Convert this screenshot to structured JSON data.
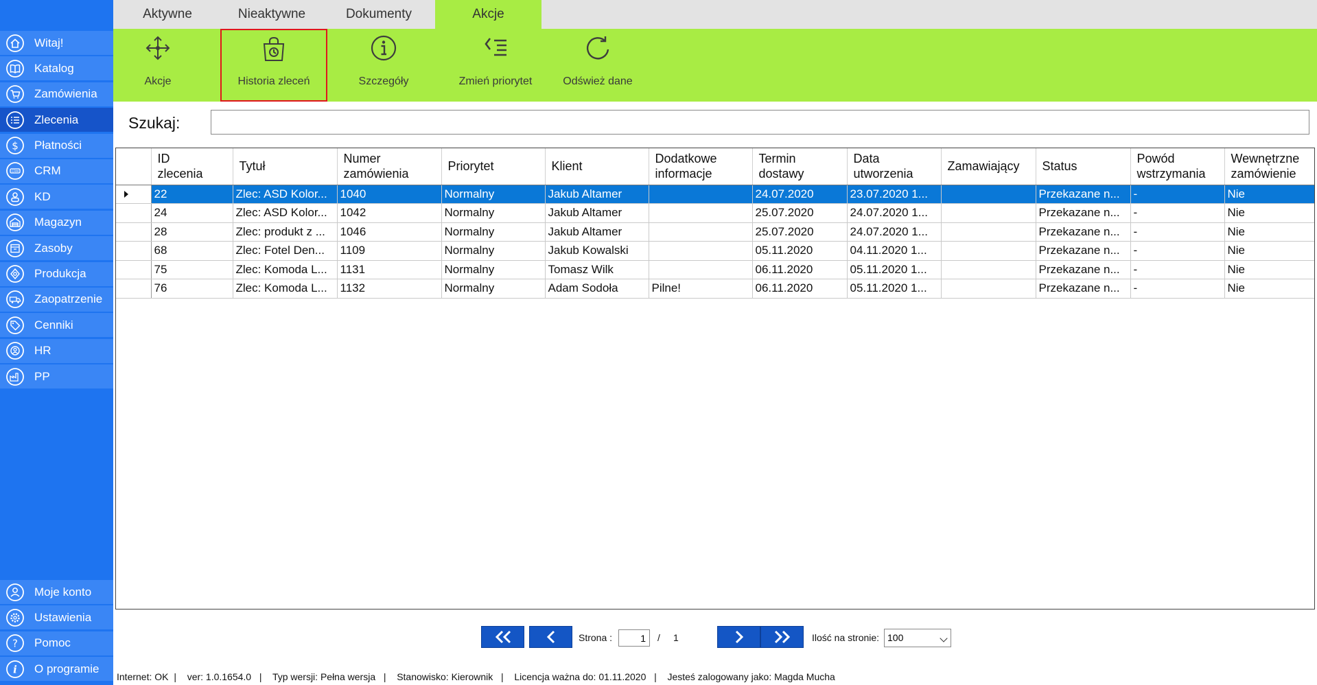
{
  "sidebar": {
    "items": [
      {
        "label": "Witaj!",
        "icon": "home-icon"
      },
      {
        "label": "Katalog",
        "icon": "book-icon"
      },
      {
        "label": "Zamówienia",
        "icon": "cart-icon"
      },
      {
        "label": "Zlecenia",
        "icon": "list-icon",
        "active": true
      },
      {
        "label": "Płatności",
        "icon": "dollar-icon"
      },
      {
        "label": "CRM",
        "icon": "crm-icon"
      },
      {
        "label": "KD",
        "icon": "person-icon"
      },
      {
        "label": "Magazyn",
        "icon": "warehouse-icon"
      },
      {
        "label": "Zasoby",
        "icon": "box-icon"
      },
      {
        "label": "Produkcja",
        "icon": "production-icon"
      },
      {
        "label": "Zaopatrzenie",
        "icon": "truck-icon"
      },
      {
        "label": "Cenniki",
        "icon": "tag-icon"
      },
      {
        "label": "HR",
        "icon": "hr-icon"
      },
      {
        "label": "PP",
        "icon": "factory-icon"
      }
    ],
    "bottom_items": [
      {
        "label": "Moje konto",
        "icon": "user-icon"
      },
      {
        "label": "Ustawienia",
        "icon": "gear-icon"
      },
      {
        "label": "Pomoc",
        "icon": "question-icon"
      },
      {
        "label": "O programie",
        "icon": "info-icon"
      }
    ]
  },
  "tabs": [
    {
      "label": "Aktywne"
    },
    {
      "label": "Nieaktywne"
    },
    {
      "label": "Dokumenty"
    },
    {
      "label": "Akcje",
      "active": true
    }
  ],
  "ribbon": {
    "buttons": [
      {
        "label": "Akcje",
        "icon": "move-arrows-icon"
      },
      {
        "label": "Historia zleceń",
        "icon": "history-bag-icon",
        "selected": true
      },
      {
        "label": "Szczegóły",
        "icon": "info-circle-icon"
      },
      {
        "label": "Zmień priorytet",
        "icon": "priority-list-icon"
      },
      {
        "label": "Odśwież dane",
        "icon": "refresh-icon"
      }
    ]
  },
  "search": {
    "label": "Szukaj:",
    "value": ""
  },
  "table": {
    "columns": [
      "ID\nzlecenia",
      "Tytuł",
      "Numer\nzamówienia",
      "Priorytet",
      "Klient",
      "Dodatkowe\ninformacje",
      "Termin\ndostawy",
      "Data\nutworzenia",
      "Zamawiający",
      "Status",
      "Powód\nwstrzymania",
      "Wewnętrzne\nzamówienie"
    ],
    "rows": [
      [
        "22",
        "Zlec: ASD Kolor...",
        "1040",
        "Normalny",
        "Jakub  Altamer",
        "",
        "24.07.2020",
        "23.07.2020 1...",
        "",
        "Przekazane n...",
        "-",
        "Nie"
      ],
      [
        "24",
        "Zlec: ASD Kolor...",
        "1042",
        "Normalny",
        "Jakub  Altamer",
        "",
        "25.07.2020",
        "24.07.2020 1...",
        "",
        "Przekazane n...",
        "-",
        "Nie"
      ],
      [
        "28",
        "Zlec: produkt z ...",
        "1046",
        "Normalny",
        "Jakub  Altamer",
        "",
        "25.07.2020",
        "24.07.2020 1...",
        "",
        "Przekazane n...",
        "-",
        "Nie"
      ],
      [
        "68",
        "Zlec: Fotel Den...",
        "1109",
        "Normalny",
        "Jakub Kowalski",
        "",
        "05.11.2020",
        "04.11.2020 1...",
        "",
        "Przekazane n...",
        "-",
        "Nie"
      ],
      [
        "75",
        "Zlec: Komoda L...",
        "1131",
        "Normalny",
        "Tomasz Wilk",
        "",
        "06.11.2020",
        "05.11.2020 1...",
        "",
        "Przekazane n...",
        "-",
        "Nie"
      ],
      [
        "76",
        "Zlec: Komoda L...",
        "1132",
        "Normalny",
        "Adam Sodoła",
        "Pilne!",
        "06.11.2020",
        "05.11.2020 1...",
        "",
        "Przekazane n...",
        "-",
        "Nie"
      ]
    ],
    "selected_row": 0
  },
  "pager": {
    "page_label": "Strona :",
    "current_page": "1",
    "separator": "/",
    "total_pages": "1",
    "per_page_label": "Ilość na stronie:",
    "per_page_value": "100"
  },
  "statusbar": {
    "internet": "Internet: OK",
    "version": "ver: 1.0.1654.0",
    "type": "Typ wersji: Pełna wersja",
    "station": "Stanowisko: Kierownik",
    "license": "Licencja ważna do: 01.11.2020",
    "user": "Jesteś zalogowany jako: Magda Mucha"
  },
  "colors": {
    "sidebar": "#1e74f0",
    "ribbon": "#a8ec44",
    "selection": "#0a78d7",
    "highlight_border": "#e0161d",
    "pager_button": "#1456c5"
  }
}
